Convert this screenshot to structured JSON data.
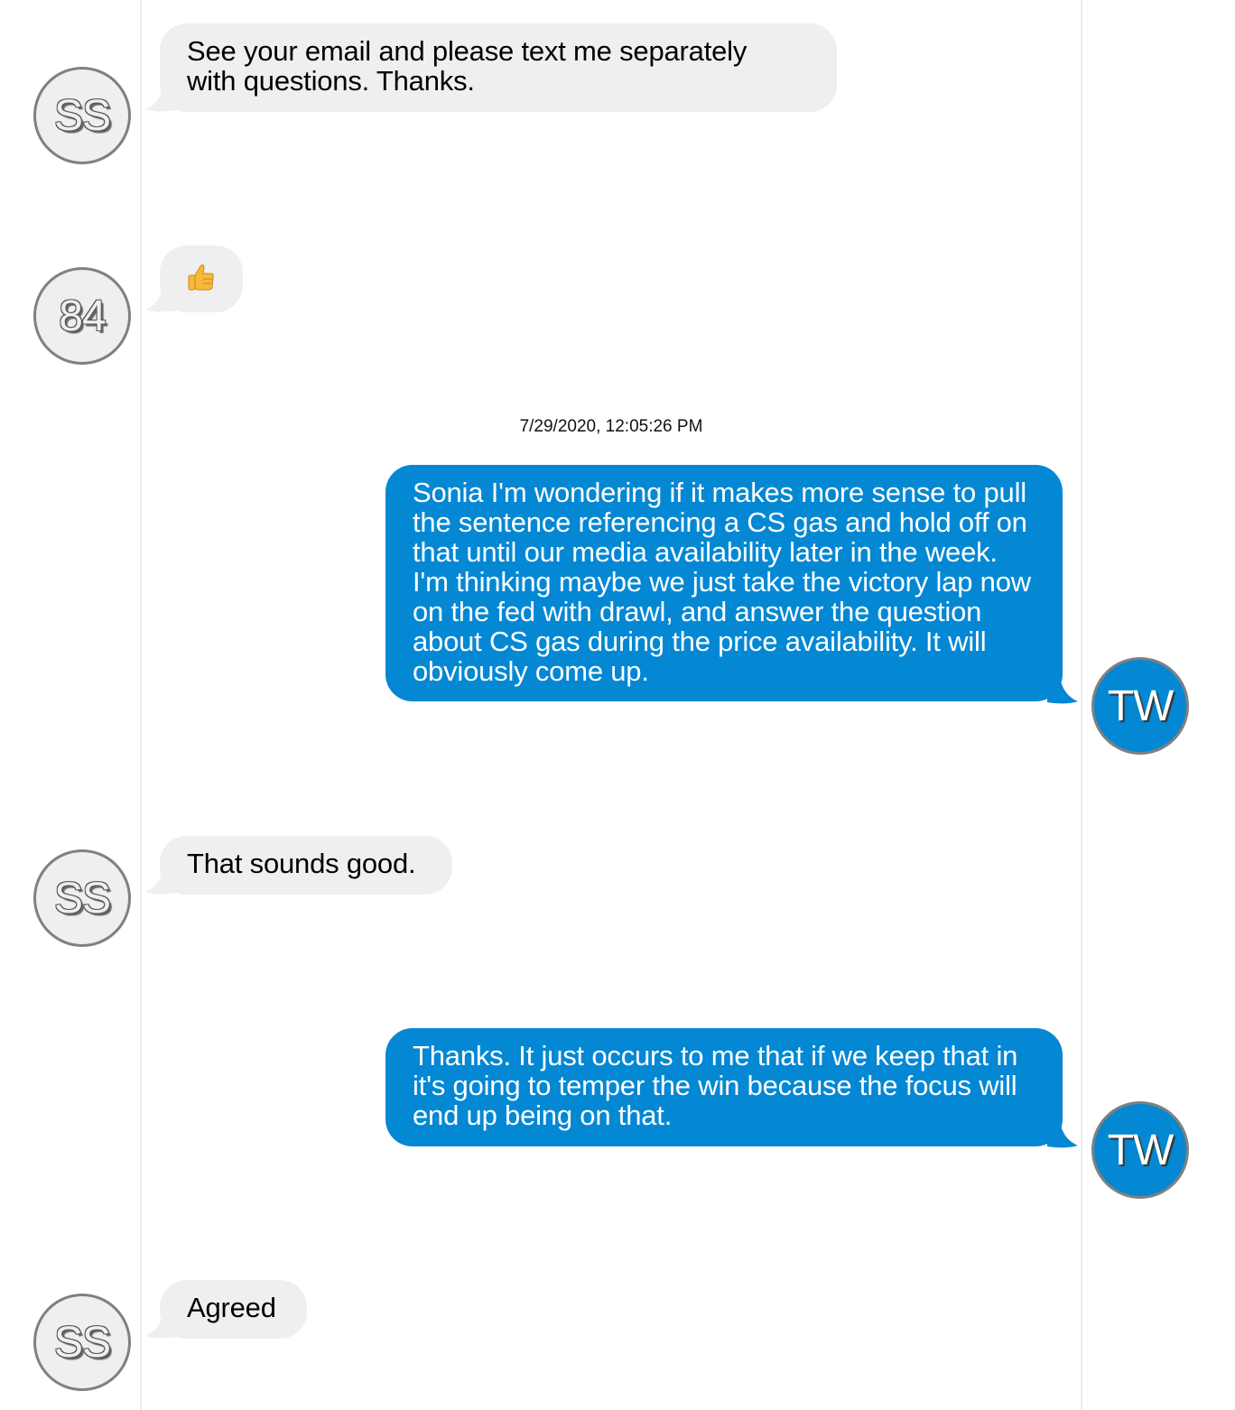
{
  "conversation": {
    "messages": [
      {
        "sender_initials": "SS",
        "direction": "incoming",
        "text": "See your email and please text me separately\nwith questions. Thanks."
      },
      {
        "sender_initials": "84",
        "direction": "incoming",
        "text": "",
        "emoji": "thumbs-up-icon"
      },
      {
        "sender_initials": "TW",
        "direction": "outgoing",
        "text": "Sonia I'm wondering if it makes more sense to pull the sentence referencing a CS gas and hold off on that until our media availability later in the week. I'm thinking maybe we just take the victory lap now on the fed with drawl, and answer the question about CS gas during the price availability. It will obviously come up."
      },
      {
        "sender_initials": "SS",
        "direction": "incoming",
        "text": "That sounds good."
      },
      {
        "sender_initials": "TW",
        "direction": "outgoing",
        "text": "Thanks. It just occurs to me that if we keep that in it's going to temper the win because the focus will end up being on that."
      },
      {
        "sender_initials": "SS",
        "direction": "incoming",
        "text": "Agreed"
      }
    ],
    "timestamp": "7/29/2020, 12:05:26 PM"
  },
  "colors": {
    "incoming_bubble": "#efefef",
    "outgoing_bubble": "#0488d4",
    "avatar_border": "#808080"
  }
}
